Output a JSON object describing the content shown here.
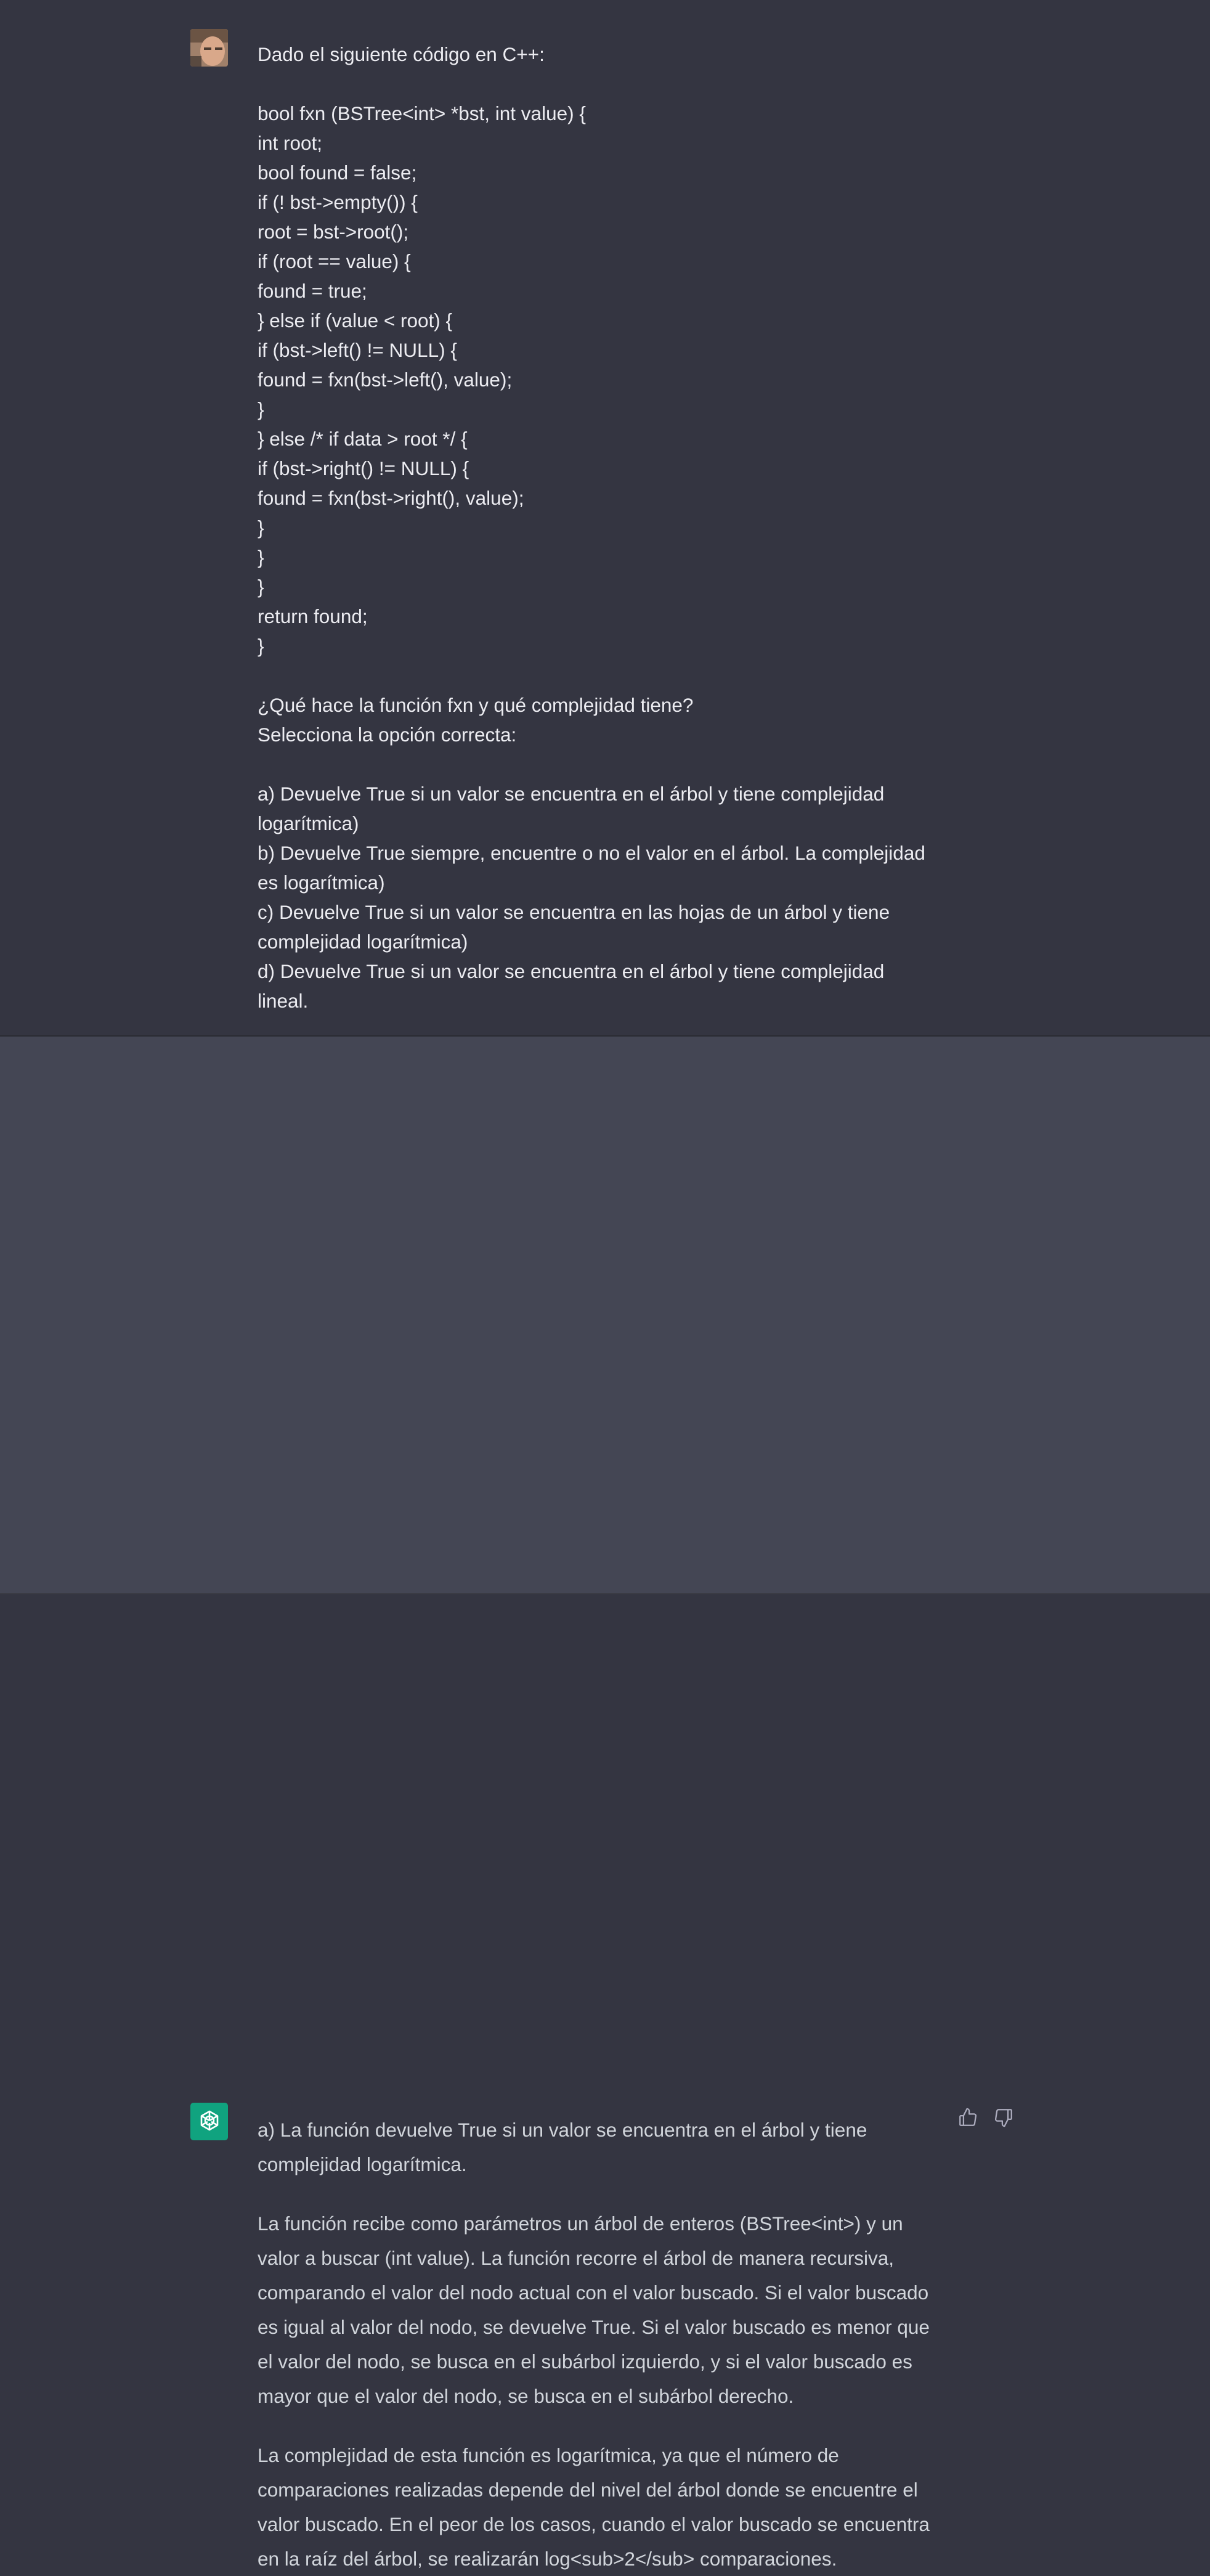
{
  "conversation": {
    "user_message": {
      "text": "Dado el siguiente código en C++:\n\nbool fxn (BSTree<int> *bst, int value) {\nint root;\nbool found = false;\nif (! bst->empty()) {\nroot = bst->root();\nif (root == value) {\nfound = true;\n} else if (value < root) {\nif (bst->left() != NULL) {\nfound = fxn(bst->left(), value);\n}\n} else /* if data > root */ {\nif (bst->right() != NULL) {\nfound = fxn(bst->right(), value);\n}\n}\n}\nreturn found;\n}\n\n¿Qué hace la función fxn y qué complejidad tiene?\nSelecciona la opción correcta:\n\na) Devuelve True si un valor se encuentra en el árbol y tiene complejidad\nlogarítmica)\nb) Devuelve True siempre, encuentre o no el valor en el árbol. La complejidad\nes logarítmica)\nc) Devuelve True si un valor se encuentra en las hojas de un árbol y tiene\ncomplejidad logarítmica)\nd) Devuelve True si un valor se encuentra en el árbol y tiene complejidad\nlineal."
    },
    "assistant_message": {
      "paragraphs": [
        "a) La función devuelve True si un valor se encuentra en el árbol y tiene complejidad logarítmica.",
        "La función recibe como parámetros un árbol de enteros (BSTree<int>) y un valor a buscar (int value). La función recorre el árbol de manera recursiva, comparando el valor del nodo actual con el valor buscado. Si el valor buscado es igual al valor del nodo, se devuelve True. Si el valor buscado es menor que el valor del nodo, se busca en el subárbol izquierdo, y si el valor buscado es mayor que el valor del nodo, se busca en el subárbol derecho.",
        "La complejidad de esta función es logarítmica, ya que el número de comparaciones realizadas depende del nivel del árbol donde se encuentre el valor buscado. En el peor de los casos, cuando el valor buscado se encuentra en la raíz del árbol, se realizarán log<sub>2</sub> comparaciones."
      ]
    }
  },
  "icons": {
    "user_avatar": "user-avatar-photo",
    "assistant_avatar": "openai-logo-icon",
    "thumbs_up": "thumbs-up-icon",
    "thumbs_down": "thumbs-down-icon"
  },
  "colors": {
    "background": "#343541",
    "assistant_background": "#444654",
    "text_user": "#ececf1",
    "text_assistant": "#d1d5db",
    "brand": "#10a37f"
  }
}
